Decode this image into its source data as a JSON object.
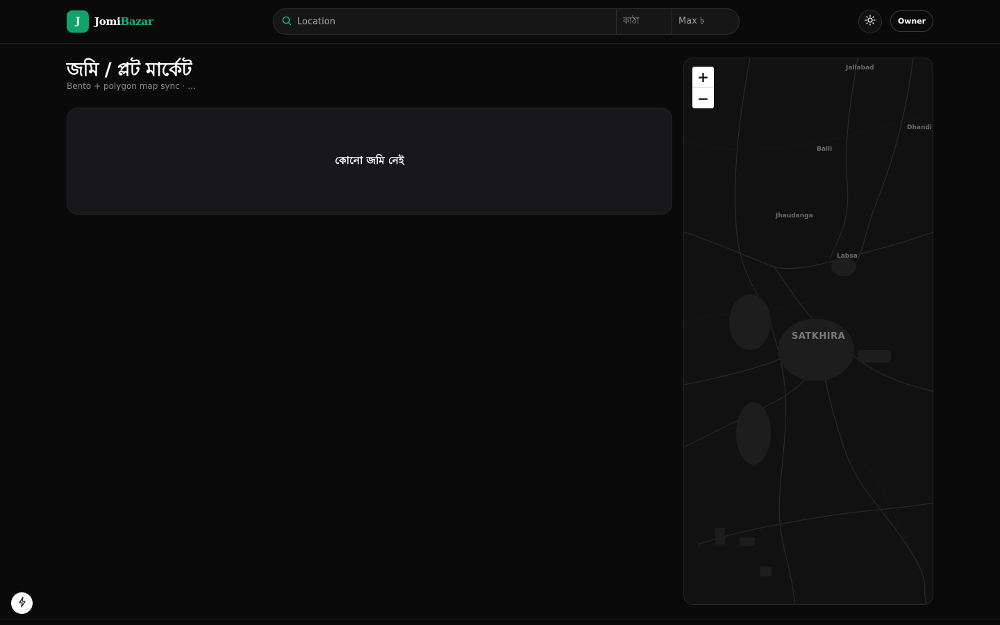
{
  "brand": {
    "mark": "J",
    "name_part1": "Jomi",
    "name_part2": "Bazar"
  },
  "search": {
    "location_placeholder": "Location",
    "unit_label": "কাঠা",
    "max_label": "Max ৳"
  },
  "header": {
    "owner_label": "Owner"
  },
  "main": {
    "title": "জমি / প্লট মার্কেট",
    "subtitle": "Bento + polygon map sync · ...",
    "empty_state": "কোনো জমি নেই"
  },
  "map": {
    "zoom_in": "+",
    "zoom_out": "−",
    "places": {
      "jallabad": "Jallabad",
      "dhandi": "Dhandi",
      "balli": "Balli",
      "jhaudanga": "Jhaudanga",
      "labsa": "Labsa",
      "satkhira": "SATKHIRA"
    }
  },
  "colors": {
    "accent": "#10a36a",
    "background": "#0a0a0a",
    "card": "#18181a"
  },
  "icons": {
    "search": "search-icon",
    "theme": "sun-icon",
    "fab": "lightning-icon"
  }
}
